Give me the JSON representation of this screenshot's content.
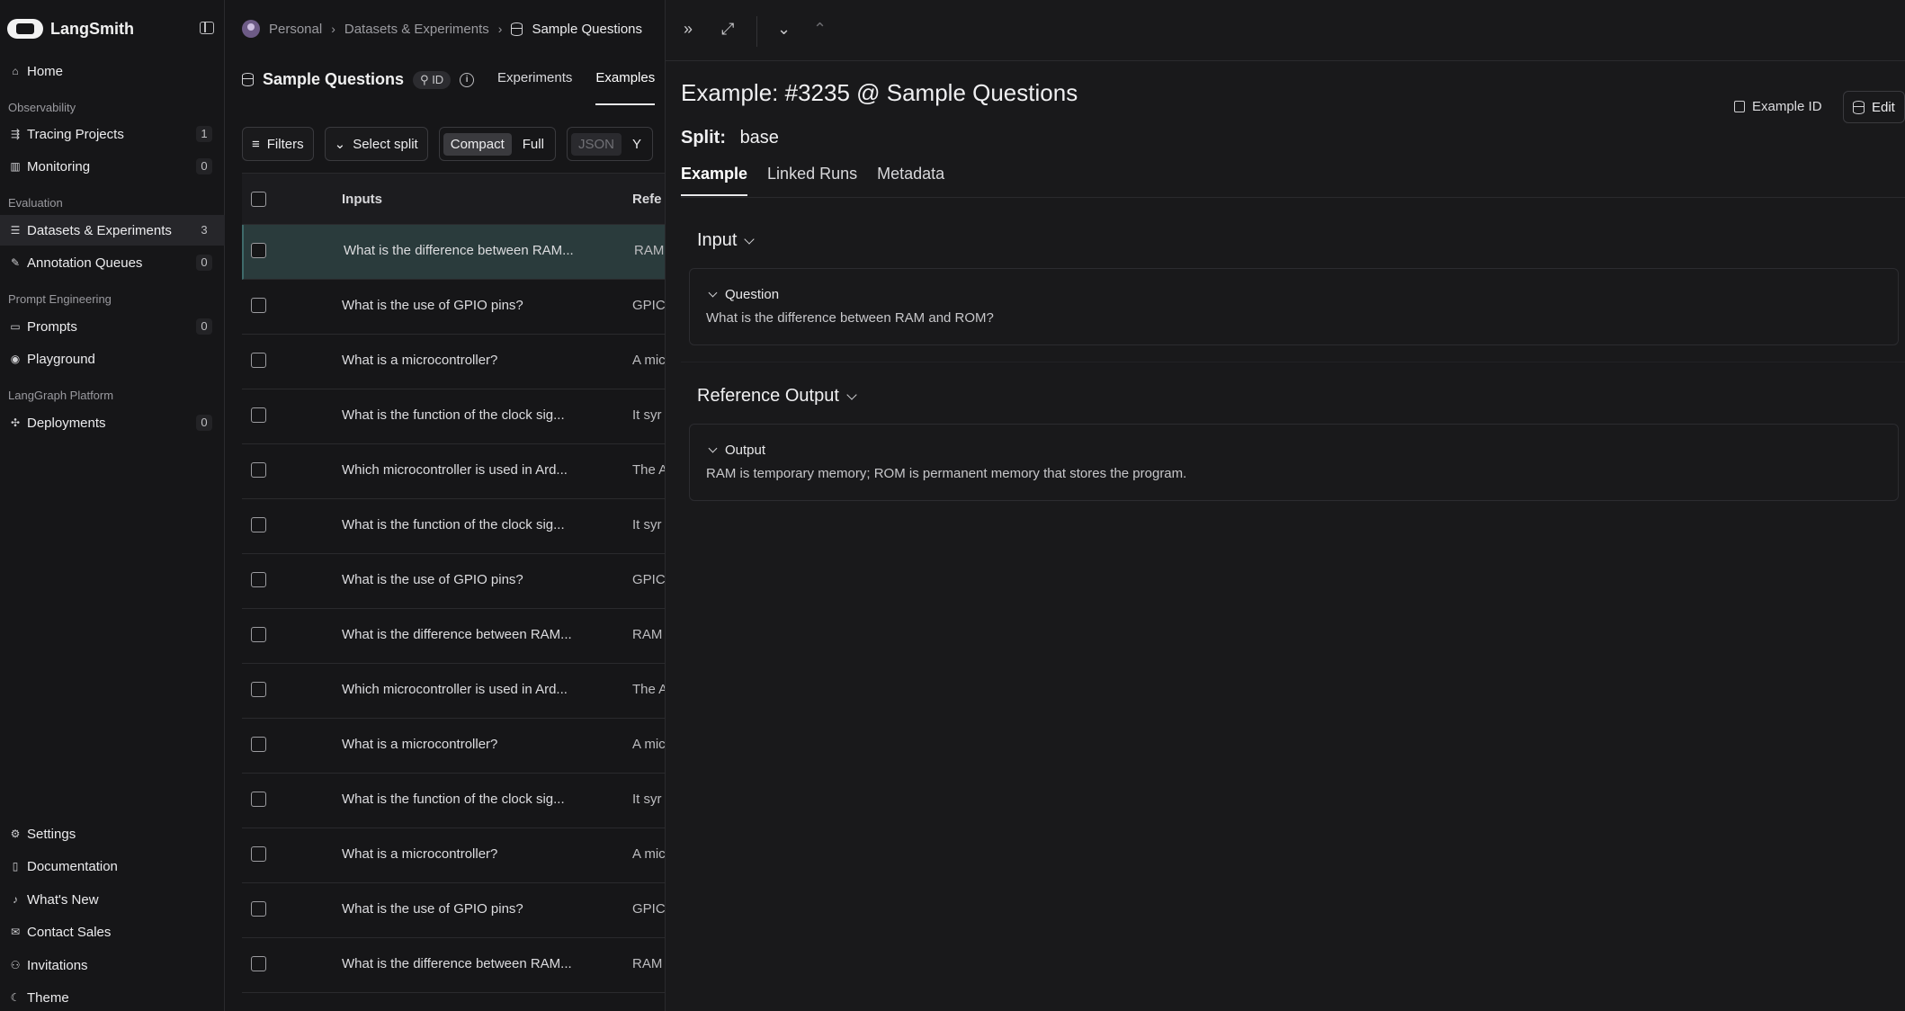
{
  "brand": {
    "name": "LangSmith"
  },
  "sidebar": {
    "top": [
      {
        "label": "Home",
        "icon": "home-icon"
      }
    ],
    "sections": [
      {
        "title": "Observability",
        "items": [
          {
            "label": "Tracing Projects",
            "badge": "1",
            "icon": "tracing-icon"
          },
          {
            "label": "Monitoring",
            "badge": "0",
            "icon": "monitoring-icon"
          }
        ]
      },
      {
        "title": "Evaluation",
        "items": [
          {
            "label": "Datasets & Experiments",
            "badge": "3",
            "icon": "database-icon",
            "active": true
          },
          {
            "label": "Annotation Queues",
            "badge": "0",
            "icon": "pencil-icon"
          }
        ]
      },
      {
        "title": "Prompt Engineering",
        "items": [
          {
            "label": "Prompts",
            "badge": "0",
            "icon": "chat-icon"
          },
          {
            "label": "Playground",
            "icon": "play-icon"
          }
        ]
      },
      {
        "title": "LangGraph Platform",
        "items": [
          {
            "label": "Deployments",
            "badge": "0",
            "icon": "deployments-icon"
          }
        ]
      }
    ],
    "bottom": [
      {
        "label": "Settings",
        "icon": "gear-icon"
      },
      {
        "label": "Documentation",
        "icon": "book-icon"
      },
      {
        "label": "What's New",
        "icon": "bell-icon"
      },
      {
        "label": "Contact Sales",
        "icon": "mail-icon"
      },
      {
        "label": "Invitations",
        "icon": "user-icon"
      },
      {
        "label": "Theme",
        "icon": "moon-icon"
      }
    ]
  },
  "breadcrumb": {
    "workspace": "Personal",
    "section": "Datasets & Experiments",
    "current": "Sample Questions"
  },
  "dataset": {
    "name": "Sample Questions",
    "id_chip": "ID",
    "tabs": [
      "Experiments",
      "Examples"
    ],
    "active_tab": "Examples"
  },
  "toolbar": {
    "filters": "Filters",
    "select_split": "Select split",
    "compact": "Compact",
    "full": "Full",
    "json": "JSON",
    "more": "Y"
  },
  "table": {
    "headers": {
      "inputs": "Inputs",
      "reference": "Refe"
    },
    "rows": [
      {
        "input": "What is the difference between RAM...",
        "ref": "RAM",
        "selected": true
      },
      {
        "input": "What is the use of GPIO pins?",
        "ref": "GPIC"
      },
      {
        "input": "What is a microcontroller?",
        "ref": "A mic"
      },
      {
        "input": "What is the function of the clock sig...",
        "ref": "It syr"
      },
      {
        "input": "Which microcontroller is used in Ard...",
        "ref": "The A"
      },
      {
        "input": "What is the function of the clock sig...",
        "ref": "It syr"
      },
      {
        "input": "What is the use of GPIO pins?",
        "ref": "GPIC"
      },
      {
        "input": "What is the difference between RAM...",
        "ref": "RAM"
      },
      {
        "input": "Which microcontroller is used in Ard...",
        "ref": "The A"
      },
      {
        "input": "What is a microcontroller?",
        "ref": "A mic"
      },
      {
        "input": "What is the function of the clock sig...",
        "ref": "It syr"
      },
      {
        "input": "What is a microcontroller?",
        "ref": "A mic"
      },
      {
        "input": "What is the use of GPIO pins?",
        "ref": "GPIC"
      },
      {
        "input": "What is the difference between RAM...",
        "ref": "RAM"
      }
    ]
  },
  "detail": {
    "title": "Example: #3235 @ Sample Questions",
    "example_id_label": "Example ID",
    "edit_label": "Edit",
    "split_label": "Split:",
    "split_value": "base",
    "tabs": [
      "Example",
      "Linked Runs",
      "Metadata"
    ],
    "input_section": "Input",
    "input_key": "Question",
    "input_value": "What is the difference between RAM and ROM?",
    "output_section": "Reference Output",
    "output_key": "Output",
    "output_value": "RAM is temporary memory; ROM is permanent memory that stores the program."
  }
}
